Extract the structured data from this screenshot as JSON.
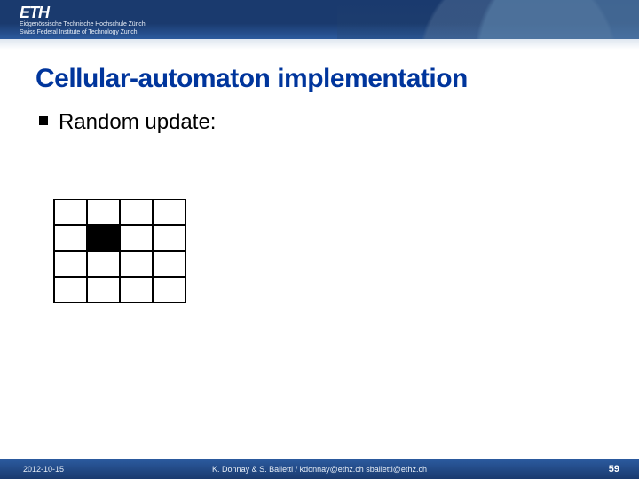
{
  "header": {
    "logo_text": "ETH",
    "subline1": "Eidgenössische Technische Hochschule Zürich",
    "subline2": "Swiss Federal Institute of Technology Zurich"
  },
  "title": "Cellular-automaton implementation",
  "body": {
    "bullet1": "Random update:"
  },
  "grid": {
    "rows": 4,
    "cols": 4,
    "filled_cells": [
      [
        1,
        1
      ]
    ]
  },
  "footer": {
    "date": "2012-10-15",
    "authors": "K. Donnay & S. Balietti / kdonnay@ethz.ch   sbalietti@ethz.ch",
    "page": "59"
  }
}
